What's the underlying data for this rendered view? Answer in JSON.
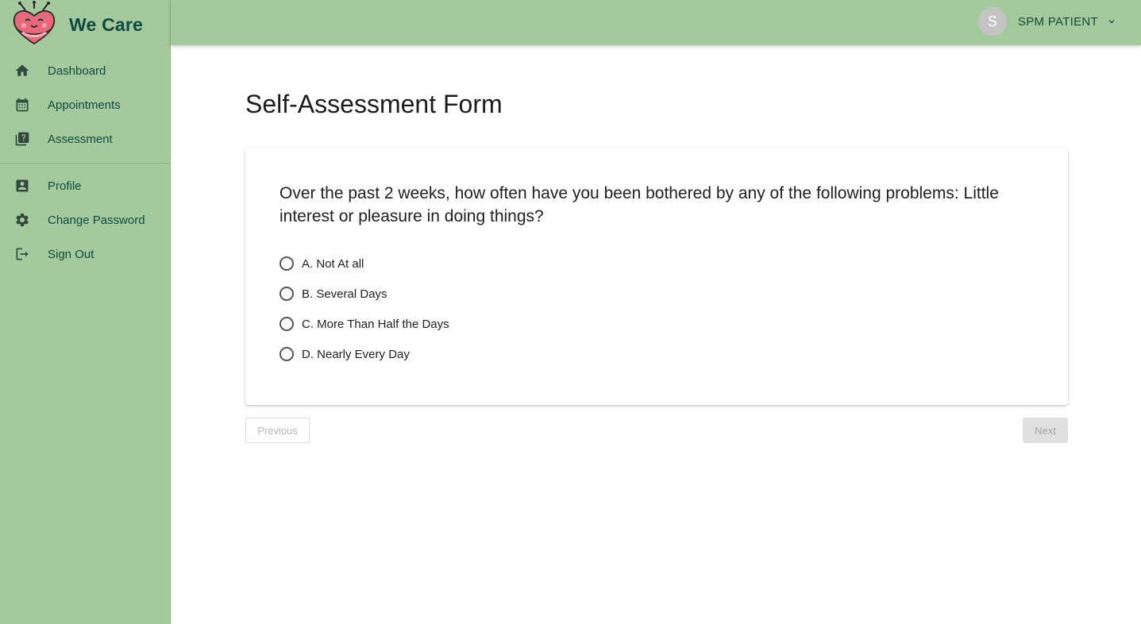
{
  "app": {
    "name": "We Care"
  },
  "sidebar": {
    "items": [
      {
        "label": "Dashboard",
        "icon": "home-icon"
      },
      {
        "label": "Appointments",
        "icon": "calendar-icon"
      },
      {
        "label": "Assessment",
        "icon": "quiz-icon"
      }
    ],
    "account_items": [
      {
        "label": "Profile",
        "icon": "person-box-icon"
      },
      {
        "label": "Change Password",
        "icon": "gear-icon"
      },
      {
        "label": "Sign Out",
        "icon": "logout-icon"
      }
    ]
  },
  "header": {
    "avatar_initial": "S",
    "user_name": "SPM PATIENT"
  },
  "main": {
    "title": "Self-Assessment Form",
    "question": "Over the past 2 weeks, how often have you been bothered by any of the following problems: Little interest or pleasure in doing things?",
    "options": [
      "A. Not At all",
      "B. Several Days",
      "C. More Than Half the Days",
      "D. Nearly Every Day"
    ],
    "previous_label": "Previous",
    "next_label": "Next"
  },
  "colors": {
    "sidebar_bg": "#a3c99d",
    "text_dark_green": "#0f4d40",
    "logo_pink": "#e8687c"
  }
}
